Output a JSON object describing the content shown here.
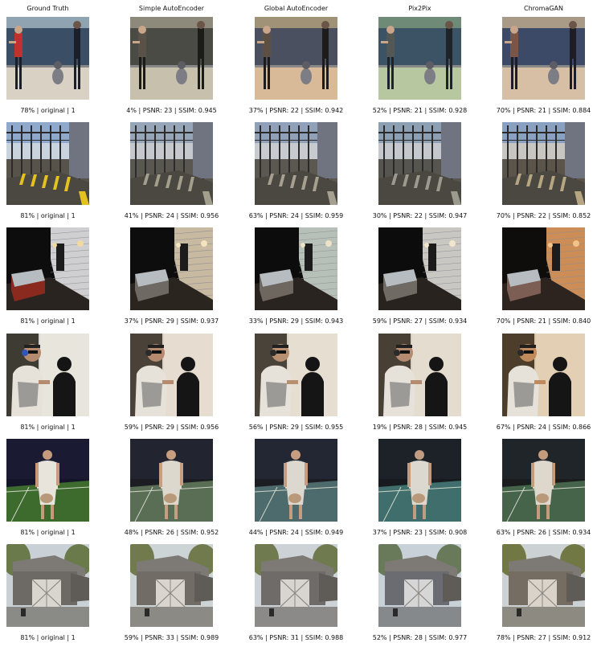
{
  "columns": [
    "Ground Truth",
    "Simple AutoEncoder",
    "Global AutoEncoder",
    "Pix2Pix",
    "ChromaGAN"
  ],
  "rows": [
    {
      "scene": "baseball",
      "captions": [
        "78% | original | 1",
        "4% | PSNR: 23 | SSIM: 0.945",
        "37% | PSNR: 22 | SSIM: 0.942",
        "52% | PSNR: 21 | SSIM: 0.928",
        "70% | PSNR: 21 | SSIM: 0.884"
      ],
      "palettes": [
        {
          "bg": "#3a4f66",
          "top": "#8fa3b1",
          "ground": "#d9d2c4",
          "fig": "#c23030",
          "accent": "#1b1f2a"
        },
        {
          "bg": "#4b4b45",
          "top": "#8d8a7c",
          "ground": "#c7c0ad",
          "fig": "#5a5249",
          "accent": "#1b1b18"
        },
        {
          "bg": "#4a5060",
          "top": "#a09277",
          "ground": "#d8b998",
          "fig": "#5c5044",
          "accent": "#1d1c1b"
        },
        {
          "bg": "#3c5265",
          "top": "#6f8b78",
          "ground": "#b7c79f",
          "fig": "#545855",
          "accent": "#1d2328"
        },
        {
          "bg": "#3d4a67",
          "top": "#a89a87",
          "ground": "#d7bfa6",
          "fig": "#7a5648",
          "accent": "#1e1d26"
        }
      ]
    },
    {
      "scene": "industrial",
      "captions": [
        "81% | original | 1",
        "41% | PSNR: 24 | SSIM: 0.956",
        "63% | PSNR: 24 | SSIM: 0.959",
        "30% | PSNR: 22 | SSIM: 0.947",
        "70% | PSNR: 22 | SSIM: 0.852"
      ],
      "palettes": [
        {
          "bg": "#8fa9cc",
          "top": "#c9d3dd",
          "ground": "#57524a",
          "fig": "#2a2a2a",
          "accent": "#e3c21f"
        },
        {
          "bg": "#96a5b8",
          "top": "#c5c9ce",
          "ground": "#5a5650",
          "fig": "#2c2c2c",
          "accent": "#a39f8d"
        },
        {
          "bg": "#8fa0b8",
          "top": "#c7cbd0",
          "ground": "#5b5751",
          "fig": "#2b2b2b",
          "accent": "#a5a08f"
        },
        {
          "bg": "#8d9fb3",
          "top": "#c4c8cc",
          "ground": "#57554f",
          "fig": "#2a2a2a",
          "accent": "#9c9a8e"
        },
        {
          "bg": "#8aa0c0",
          "top": "#c8c6c0",
          "ground": "#5a544a",
          "fig": "#2b2a28",
          "accent": "#b7a682"
        }
      ]
    },
    {
      "scene": "hottub",
      "captions": [
        "81% | original | 1",
        "37% | PSNR: 29 | SSIM: 0.937",
        "33% | PSNR: 29 | SSIM: 0.943",
        "59% | PSNR: 27 | SSIM: 0.934",
        "70% | PSNR: 21 | SSIM: 0.840"
      ],
      "palettes": [
        {
          "bg": "#0d0d0d",
          "top": "#cfcfd1",
          "ground": "#2a2420",
          "fig": "#8a2a1e",
          "accent": "#f2d9a0"
        },
        {
          "bg": "#0d0d0d",
          "top": "#c8b9a1",
          "ground": "#2b2520",
          "fig": "#6e6a63",
          "accent": "#f4e2bd"
        },
        {
          "bg": "#0c0c0c",
          "top": "#b7c0b8",
          "ground": "#2a2420",
          "fig": "#6e6760",
          "accent": "#ede2c7"
        },
        {
          "bg": "#0c0c0c",
          "top": "#c9c7c2",
          "ground": "#29231f",
          "fig": "#706a64",
          "accent": "#f1e5cb"
        },
        {
          "bg": "#0e0d0c",
          "top": "#cc8d56",
          "ground": "#2d2420",
          "fig": "#7d5e55",
          "accent": "#f3c48a"
        }
      ]
    },
    {
      "scene": "shooter",
      "captions": [
        "81% | original | 1",
        "59% | PSNR: 29 | SSIM: 0.956",
        "56% | PSNR: 29 | SSIM: 0.955",
        "19% | PSNR: 28 | SSIM: 0.945",
        "67% | PSNR: 24 | SSIM: 0.866"
      ],
      "palettes": [
        {
          "bg": "#3e3b33",
          "top": "#d8d6d0",
          "ground": "#e8e5dd",
          "fig": "#b48b6f",
          "accent": "#2f56b8"
        },
        {
          "bg": "#4a4238",
          "top": "#d9d1c4",
          "ground": "#e6ddd0",
          "fig": "#b58a6f",
          "accent": "#2b2b2b"
        },
        {
          "bg": "#4a4339",
          "top": "#dcd4c6",
          "ground": "#e6ded1",
          "fig": "#b98f72",
          "accent": "#2b2b2b"
        },
        {
          "bg": "#483f35",
          "top": "#d9d0c2",
          "ground": "#e4dccf",
          "fig": "#b48b70",
          "accent": "#2b2b2b"
        },
        {
          "bg": "#4d3e2c",
          "top": "#ddc5a4",
          "ground": "#e2cfb4",
          "fig": "#c08a5c",
          "accent": "#2b2a28"
        }
      ]
    },
    {
      "scene": "tennis",
      "captions": [
        "81% | original | 1",
        "48% | PSNR: 26 | SSIM: 0.952",
        "44% | PSNR: 24 | SSIM: 0.949",
        "37% | PSNR: 23 | SSIM: 0.908",
        "63% | PSNR: 26 | SSIM: 0.934"
      ],
      "palettes": [
        {
          "bg": "#15152a",
          "top": "#1a1a33",
          "ground": "#3d6b2e",
          "fig": "#e8e4dc",
          "accent": "#c69b7b"
        },
        {
          "bg": "#1c1d22",
          "top": "#222430",
          "ground": "#5a6e55",
          "fig": "#ddd8ce",
          "accent": "#c79e80"
        },
        {
          "bg": "#1b1d22",
          "top": "#232733",
          "ground": "#4d6a6d",
          "fig": "#ddd8cf",
          "accent": "#c69d80"
        },
        {
          "bg": "#171b1f",
          "top": "#1d2229",
          "ground": "#3f6e6c",
          "fig": "#dcd8cf",
          "accent": "#bf9c82"
        },
        {
          "bg": "#1a1c1e",
          "top": "#20252a",
          "ground": "#46644a",
          "fig": "#ddd7cc",
          "accent": "#c49c7c"
        }
      ]
    },
    {
      "scene": "stable",
      "captions": [
        "81% | original | 1",
        "59% | PSNR: 33 | SSIM: 0.989",
        "63% | PSNR: 31 | SSIM: 0.988",
        "52% | PSNR: 28 | SSIM: 0.977",
        "78% | PSNR: 27 | SSIM: 0.912"
      ],
      "palettes": [
        {
          "bg": "#c9d1d6",
          "top": "#6a7a4a",
          "ground": "#8a8a86",
          "fig": "#6d6a66",
          "accent": "#d9d5cf"
        },
        {
          "bg": "#cdd4d6",
          "top": "#707a4c",
          "ground": "#8c8a85",
          "fig": "#716c66",
          "accent": "#d9d5ce"
        },
        {
          "bg": "#ccd2d6",
          "top": "#6f7a4f",
          "ground": "#8b8a88",
          "fig": "#6f6b69",
          "accent": "#d8d5d0"
        },
        {
          "bg": "#c9d1d8",
          "top": "#687a5a",
          "ground": "#85898c",
          "fig": "#6a6c72",
          "accent": "#d6d6d6"
        },
        {
          "bg": "#ccd2d3",
          "top": "#727844",
          "ground": "#8d8a82",
          "fig": "#756c62",
          "accent": "#dad3c9"
        }
      ]
    }
  ]
}
